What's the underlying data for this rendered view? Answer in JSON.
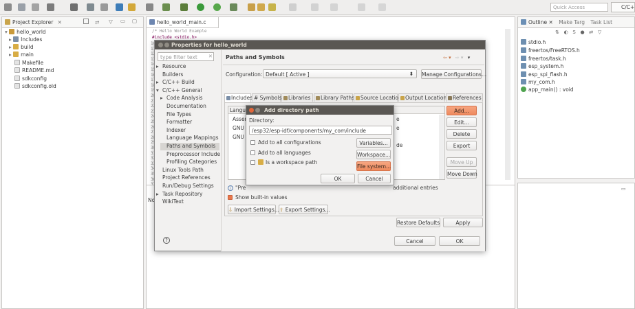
{
  "toolbar": {
    "quick_access": "Quick Access",
    "perspective": "C/C++"
  },
  "project_explorer": {
    "title": "Project Explorer",
    "items": [
      {
        "label": "hello_world",
        "icon": "project-folder-icon"
      },
      {
        "label": "Includes",
        "icon": "includes-icon"
      },
      {
        "label": "build",
        "icon": "folder-icon"
      },
      {
        "label": "main",
        "icon": "folder-icon"
      },
      {
        "label": "Makefile",
        "icon": "file-icon"
      },
      {
        "label": "README.md",
        "icon": "file-icon"
      },
      {
        "label": "sdkconfig",
        "icon": "file-icon"
      },
      {
        "label": "sdkconfig.old",
        "icon": "file-icon"
      }
    ]
  },
  "editor": {
    "tab": "hello_world_main.c",
    "line1": "/* Hello World Example",
    "line2": "#include <stdio.h>",
    "line_numbers": [
      "10",
      "11",
      "12",
      "13",
      "14",
      "15",
      "16",
      "17",
      "18",
      "19",
      "20",
      "21",
      "22",
      "23",
      "24",
      "25",
      "26",
      "27",
      "28",
      "29",
      "30",
      "31",
      "32",
      "33",
      "34",
      "35",
      "36",
      "37"
    ]
  },
  "outline": {
    "title": "Outline",
    "tab2": "Make Targ",
    "tab3": "Task List",
    "items": [
      "stdio.h",
      "freertos/FreeRTOS.h",
      "freertos/task.h",
      "esp_system.h",
      "esp_spi_flash.h",
      "my_com.h",
      "app_main() : void"
    ]
  },
  "bottom_panel": {
    "text": "No"
  },
  "properties": {
    "title": "Properties for hello_world",
    "filter_placeholder": "type filter text",
    "nav": [
      "Resource",
      "Builders",
      "C/C++ Build",
      "C/C++ General",
      "Code Analysis",
      "Documentation",
      "File Types",
      "Formatter",
      "Indexer",
      "Language Mappings",
      "Paths and Symbols",
      "Preprocessor Include",
      "Profiling Categories",
      "Linux Tools Path",
      "Project References",
      "Run/Debug Settings",
      "Task Repository",
      "WikiText"
    ],
    "heading": "Paths and Symbols",
    "config_label": "Configuration:",
    "config_value": "Default  [ Active ]",
    "manage_btn": "Manage Configurations...",
    "tabs": [
      "Includes",
      "# Symbols",
      "Libraries",
      "Library Paths",
      "Source Location",
      "Output Location",
      "References"
    ],
    "table_header": "Languag",
    "table_rows": [
      "Assem",
      "GNU C",
      "GNU C"
    ],
    "table_right": [
      "e",
      "e",
      "de"
    ],
    "side_buttons": [
      "Add...",
      "Edit...",
      "Delete",
      "Export",
      "Move Up",
      "Move Down"
    ],
    "info_text": "\"Pre",
    "info_right": "additional entries",
    "show_builtin": "Show built-in values",
    "import_btn": "Import Settings...",
    "export_btn": "Export Settings...",
    "restore_btn": "Restore Defaults",
    "apply_btn": "Apply",
    "cancel_btn": "Cancel",
    "ok_btn": "OK"
  },
  "add_dir": {
    "title": "Add directory path",
    "directory_label": "Directory:",
    "directory_value": "/esp32/esp-idf/components/my_com/include",
    "all_configs": "Add to all configurations",
    "all_langs": "Add to all languages",
    "workspace_path": "Is a workspace path",
    "variables_btn": "Variables...",
    "workspace_btn": "Workspace...",
    "filesystem_btn": "File system...",
    "ok_btn": "OK",
    "cancel_btn": "Cancel"
  }
}
